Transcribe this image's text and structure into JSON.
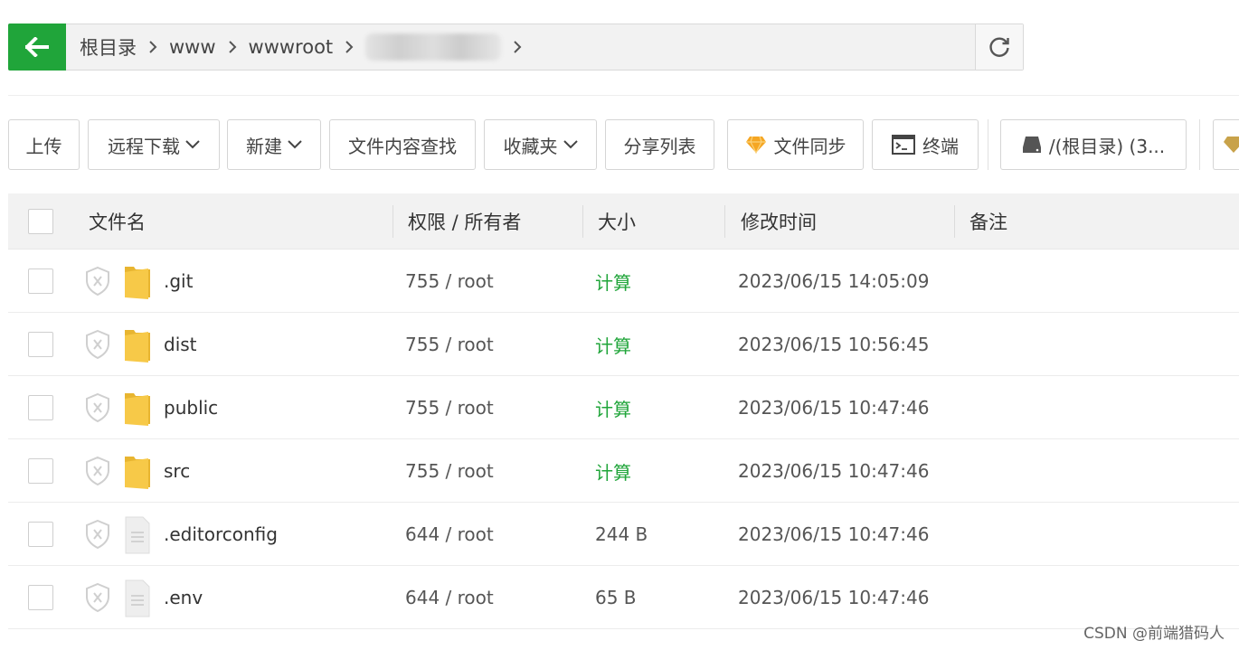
{
  "pathbar": {
    "back_icon": "arrow-left-icon",
    "crumbs": [
      "根目录",
      "www",
      "wwwroot"
    ],
    "refresh_icon": "refresh-icon"
  },
  "toolbar": {
    "upload": "上传",
    "remote_download": "远程下载",
    "new": "新建",
    "content_search": "文件内容查找",
    "favorites": "收藏夹",
    "share_list": "分享列表",
    "file_sync": "文件同步",
    "terminal": "终端",
    "disk": "/(根目录) (3..."
  },
  "table": {
    "headers": {
      "name": "文件名",
      "perm": "权限 / 所有者",
      "size": "大小",
      "mtime": "修改时间",
      "note": "备注"
    },
    "rows": [
      {
        "name": ".git",
        "type": "folder",
        "perm": "755 / root",
        "size": "计算",
        "mtime": "2023/06/15 14:05:09"
      },
      {
        "name": "dist",
        "type": "folder",
        "perm": "755 / root",
        "size": "计算",
        "mtime": "2023/06/15 10:56:45"
      },
      {
        "name": "public",
        "type": "folder",
        "perm": "755 / root",
        "size": "计算",
        "mtime": "2023/06/15 10:47:46"
      },
      {
        "name": "src",
        "type": "folder",
        "perm": "755 / root",
        "size": "计算",
        "mtime": "2023/06/15 10:47:46"
      },
      {
        "name": ".editorconfig",
        "type": "file",
        "perm": "644 / root",
        "size": "244 B",
        "mtime": "2023/06/15 10:47:46"
      },
      {
        "name": ".env",
        "type": "file",
        "perm": "644 / root",
        "size": "65 B",
        "mtime": "2023/06/15 10:47:46"
      }
    ]
  },
  "watermark": "CSDN @前端猎码人",
  "colors": {
    "accent": "#20a53a",
    "folder": "#f7c948",
    "header_bg": "#f2f2f2"
  }
}
